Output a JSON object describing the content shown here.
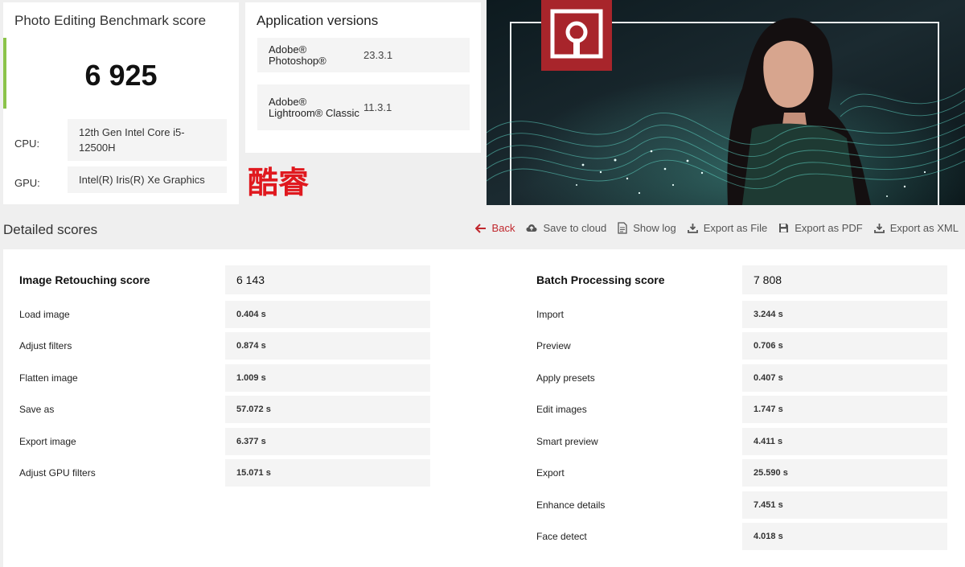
{
  "score_card": {
    "title": "Photo Editing Benchmark score",
    "score": "6 925",
    "cpu_label": "CPU:",
    "cpu_value": "12th Gen Intel Core i5-12500H",
    "gpu_label": "GPU:",
    "gpu_value": "Intel(R) Iris(R) Xe Graphics"
  },
  "versions": {
    "title": "Application versions",
    "apps": [
      {
        "name": "Adobe® Photoshop®",
        "version": "23.3.1"
      },
      {
        "name": "Adobe® Lightroom® Classic",
        "version": "11.3.1"
      }
    ]
  },
  "brand_text": "酷睿",
  "detailed": {
    "title": "Detailed scores",
    "toolbar": {
      "back": "Back",
      "save_cloud": "Save to cloud",
      "show_log": "Show log",
      "export_file": "Export as File",
      "export_pdf": "Export as PDF",
      "export_xml": "Export as XML"
    },
    "retouching": {
      "label": "Image Retouching score",
      "score": "6 143",
      "items": [
        {
          "label": "Load image",
          "value": "0.404 s"
        },
        {
          "label": "Adjust filters",
          "value": "0.874 s"
        },
        {
          "label": "Flatten image",
          "value": "1.009 s"
        },
        {
          "label": "Save as",
          "value": "57.072 s"
        },
        {
          "label": "Export image",
          "value": "6.377 s"
        },
        {
          "label": "Adjust GPU filters",
          "value": "15.071 s"
        }
      ]
    },
    "batch": {
      "label": "Batch Processing score",
      "score": "7 808",
      "items": [
        {
          "label": "Import",
          "value": "3.244 s"
        },
        {
          "label": "Preview",
          "value": "0.706 s"
        },
        {
          "label": "Apply presets",
          "value": "0.407 s"
        },
        {
          "label": "Edit images",
          "value": "1.747 s"
        },
        {
          "label": "Smart preview",
          "value": "4.411 s"
        },
        {
          "label": "Export",
          "value": "25.590 s"
        },
        {
          "label": "Enhance details",
          "value": "7.451 s"
        },
        {
          "label": "Face detect",
          "value": "4.018 s"
        }
      ]
    }
  },
  "colors": {
    "accent_green": "#8bc34a",
    "back_red": "#c0272d",
    "brand_red": "#e0191f",
    "logo_red": "#a8252b",
    "wave_teal": "#5fd6c4"
  },
  "icons": {
    "back": "arrow-left-icon",
    "save_cloud": "cloud-upload-icon",
    "show_log": "document-icon",
    "export_file": "download-icon",
    "export_pdf": "floppy-disk-icon",
    "export_xml": "download-icon",
    "banner_logo": "photo-frame-logo-icon"
  }
}
